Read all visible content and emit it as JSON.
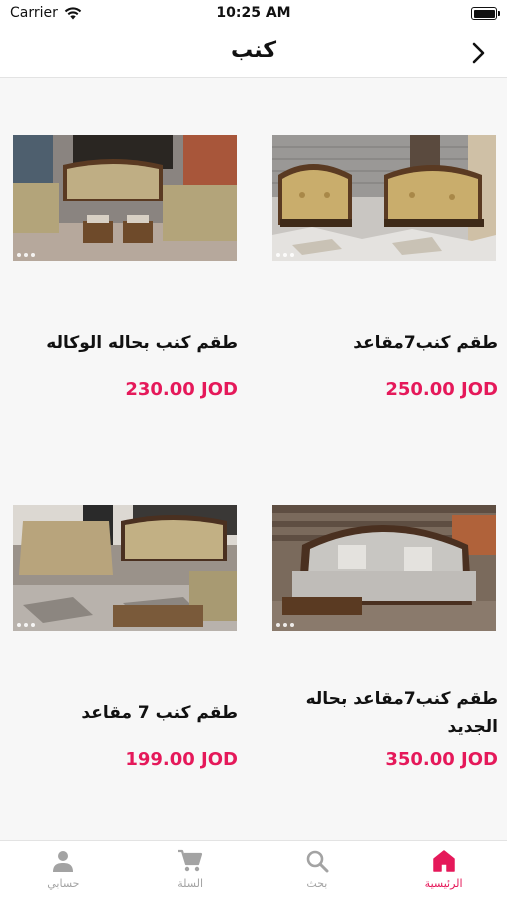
{
  "status_bar": {
    "carrier": "Carrier",
    "time": "10:25 AM"
  },
  "nav": {
    "title": "كنب"
  },
  "products": [
    {
      "title": "طقم كنب7مقاعد",
      "price": "250.00 JOD"
    },
    {
      "title": "طقم كنب بحاله الوكاله",
      "price": "230.00 JOD"
    },
    {
      "title": "طقم كنب7مقاعد بحاله الجديد",
      "price": "350.00 JOD"
    },
    {
      "title": "طقم كنب 7 مقاعد",
      "price": "199.00 JOD"
    }
  ],
  "tabs": [
    {
      "label": "الرئيسية",
      "icon": "home-icon",
      "active": true
    },
    {
      "label": "بحث",
      "icon": "search-icon",
      "active": false
    },
    {
      "label": "السلة",
      "icon": "cart-icon",
      "active": false
    },
    {
      "label": "حسابي",
      "icon": "user-icon",
      "active": false
    }
  ],
  "colors": {
    "accent": "#e5195a",
    "inactive": "#a3a3a3"
  }
}
